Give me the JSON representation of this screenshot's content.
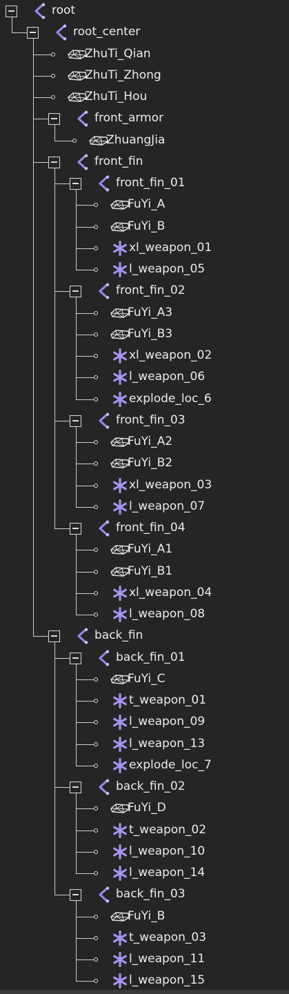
{
  "tree": [
    {
      "label": "root",
      "type": "bone",
      "depth": 0,
      "expandable": true
    },
    {
      "label": "root_center",
      "type": "bone",
      "depth": 1,
      "expandable": true
    },
    {
      "label": "ZhuTi_Qian",
      "type": "mesh",
      "depth": 2,
      "expandable": false
    },
    {
      "label": "ZhuTi_Zhong",
      "type": "mesh",
      "depth": 2,
      "expandable": false
    },
    {
      "label": "ZhuTi_Hou",
      "type": "mesh",
      "depth": 2,
      "expandable": false
    },
    {
      "label": "front_armor",
      "type": "bone",
      "depth": 2,
      "expandable": true
    },
    {
      "label": "ZhuangJia",
      "type": "mesh",
      "depth": 3,
      "expandable": false
    },
    {
      "label": "front_fin",
      "type": "bone",
      "depth": 2,
      "expandable": true
    },
    {
      "label": "front_fin_01",
      "type": "bone",
      "depth": 3,
      "expandable": true
    },
    {
      "label": "FuYi_A",
      "type": "mesh",
      "depth": 4,
      "expandable": false
    },
    {
      "label": "FuYi_B",
      "type": "mesh",
      "depth": 4,
      "expandable": false
    },
    {
      "label": "xl_weapon_01",
      "type": "locator",
      "depth": 4,
      "expandable": false
    },
    {
      "label": "l_weapon_05",
      "type": "locator",
      "depth": 4,
      "expandable": false
    },
    {
      "label": "front_fin_02",
      "type": "bone",
      "depth": 3,
      "expandable": true
    },
    {
      "label": "FuYi_A3",
      "type": "mesh",
      "depth": 4,
      "expandable": false
    },
    {
      "label": "FuYi_B3",
      "type": "mesh",
      "depth": 4,
      "expandable": false
    },
    {
      "label": "xl_weapon_02",
      "type": "locator",
      "depth": 4,
      "expandable": false
    },
    {
      "label": "l_weapon_06",
      "type": "locator",
      "depth": 4,
      "expandable": false
    },
    {
      "label": "explode_loc_6",
      "type": "locator",
      "depth": 4,
      "expandable": false
    },
    {
      "label": "front_fin_03",
      "type": "bone",
      "depth": 3,
      "expandable": true
    },
    {
      "label": "FuYi_A2",
      "type": "mesh",
      "depth": 4,
      "expandable": false
    },
    {
      "label": "FuYi_B2",
      "type": "mesh",
      "depth": 4,
      "expandable": false
    },
    {
      "label": "xl_weapon_03",
      "type": "locator",
      "depth": 4,
      "expandable": false
    },
    {
      "label": "l_weapon_07",
      "type": "locator",
      "depth": 4,
      "expandable": false
    },
    {
      "label": "front_fin_04",
      "type": "bone",
      "depth": 3,
      "expandable": true
    },
    {
      "label": "FuYi_A1",
      "type": "mesh",
      "depth": 4,
      "expandable": false
    },
    {
      "label": "FuYi_B1",
      "type": "mesh",
      "depth": 4,
      "expandable": false
    },
    {
      "label": "xl_weapon_04",
      "type": "locator",
      "depth": 4,
      "expandable": false
    },
    {
      "label": "l_weapon_08",
      "type": "locator",
      "depth": 4,
      "expandable": false
    },
    {
      "label": "back_fin",
      "type": "bone",
      "depth": 2,
      "expandable": true
    },
    {
      "label": "back_fin_01",
      "type": "bone",
      "depth": 3,
      "expandable": true
    },
    {
      "label": "FuYi_C",
      "type": "mesh",
      "depth": 4,
      "expandable": false
    },
    {
      "label": "t_weapon_01",
      "type": "locator",
      "depth": 4,
      "expandable": false
    },
    {
      "label": "l_weapon_09",
      "type": "locator",
      "depth": 4,
      "expandable": false
    },
    {
      "label": "l_weapon_13",
      "type": "locator",
      "depth": 4,
      "expandable": false
    },
    {
      "label": "explode_loc_7",
      "type": "locator",
      "depth": 4,
      "expandable": false
    },
    {
      "label": "back_fin_02",
      "type": "bone",
      "depth": 3,
      "expandable": true
    },
    {
      "label": "FuYi_D",
      "type": "mesh",
      "depth": 4,
      "expandable": false
    },
    {
      "label": "t_weapon_02",
      "type": "locator",
      "depth": 4,
      "expandable": false
    },
    {
      "label": "l_weapon_10",
      "type": "locator",
      "depth": 4,
      "expandable": false
    },
    {
      "label": "l_weapon_14",
      "type": "locator",
      "depth": 4,
      "expandable": false
    },
    {
      "label": "back_fin_03",
      "type": "bone",
      "depth": 3,
      "expandable": true
    },
    {
      "label": "FuYi_B",
      "type": "mesh",
      "depth": 4,
      "expandable": false
    },
    {
      "label": "t_weapon_03",
      "type": "locator",
      "depth": 4,
      "expandable": false
    },
    {
      "label": "l_weapon_11",
      "type": "locator",
      "depth": 4,
      "expandable": false
    },
    {
      "label": "l_weapon_15",
      "type": "locator",
      "depth": 4,
      "expandable": false
    }
  ],
  "icons": {
    "bone": "bone-icon",
    "mesh": "mesh-icon",
    "locator": "locator-icon"
  },
  "colors": {
    "background": "#252525",
    "text": "#ececec",
    "lines": "#cfcfcf",
    "bone_icon": "#9b88e6",
    "locator_icon": "#a894f2",
    "mesh_icon": "#e6e6e6"
  }
}
